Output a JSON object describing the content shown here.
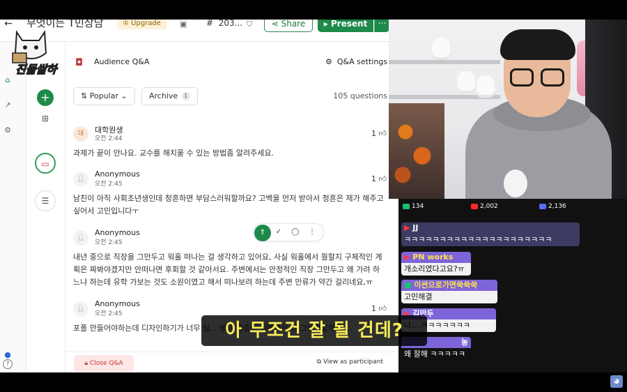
{
  "app": {
    "title": "무엇이든 T민상담",
    "upgrade": "Upgrade",
    "event_code": "203...",
    "share": "Share",
    "present": "Present",
    "more": "⋯"
  },
  "logo": {
    "text": "진돌쌀하"
  },
  "panel": {
    "title": "Audience Q&A",
    "settings": "Q&A settings",
    "sort_label": "Popular",
    "archive_label": "Archive",
    "archive_count": "1",
    "question_count": "105 questions",
    "close_qa": "Close Q&A",
    "view_as_participant": "View as participant"
  },
  "questions": [
    {
      "avatar": "대",
      "author": "대학원생",
      "time": "오전 2:44",
      "likes": "1",
      "text": "과제가 끝이 안나요. 교수를 해치울 수 있는 방법좀 알려주세요."
    },
    {
      "avatar": "",
      "author": "Anonymous",
      "time": "오전 2:45",
      "likes": "1",
      "text": "남친이 아직 사회초년생인데 청혼하면 부담스러워할까요? 고백을 먼저 받아서 청혼은 제가 해주고 싶어서 고민입니다ㅜ"
    },
    {
      "avatar": "",
      "author": "Anonymous",
      "time": "오전 2:45",
      "likes": "",
      "text": "내년 중으로 직장을 그만두고 워홀 떠나는 걸 생각하고 있어요, 사실 워홀에서 뭘할지 구체적인 계획은 짜봐야겠지만 안떠나면 후회할 것 같아서요. 주변에서는 안정적인 직장 그만두고 왜 가려 하느냐 하는데 유학 가보는 것도 소원이였고 해서 떠나보려 하는데 주변 만류가 약간 걸리네요,ㅠ"
    },
    {
      "avatar": "",
      "author": "Anonymous",
      "time": "오전 2:45",
      "likes": "1",
      "text": "포폴 만들어야하는데 디자인하기가 너무 싫... 병/우울증이 심해져서 더 그런것같아요 ..."
    }
  ],
  "stream": {
    "stats": [
      {
        "platform": "chzzk",
        "color": "#18c26e",
        "count": "134"
      },
      {
        "platform": "youtube",
        "color": "#ff2a2a",
        "count": "2,002"
      },
      {
        "platform": "other",
        "color": "#5b6cff",
        "count": "2,136"
      }
    ],
    "subtitle": "아 무조건 잘 될 건데?",
    "chat": [
      {
        "name": "JJ",
        "name_color": "#6a5acd",
        "message": "ㅋㅋㅋㅋㅋㅋㅋㅋㅋㅋㅋㅋㅋㅋㅋㅋㅋㅋㅋㅋㅋ"
      },
      {
        "name": "PN works",
        "name_color": "#7d64d8",
        "message": "개소리였다고요?ㅠ"
      },
      {
        "name": "이싼으로가면쑥쑥쑥",
        "name_color": "#7d64d8",
        "message": "고민해결"
      },
      {
        "name": "김만두",
        "name_color": "#7d64d8",
        "message": "나....ㅋㅋㅋㅋㅋㅋㅋ"
      },
      {
        "name": "농",
        "name_color": "#7d64d8",
        "message": "왜 잘해 ㅋㅋㅋㅋㅋ"
      }
    ]
  }
}
